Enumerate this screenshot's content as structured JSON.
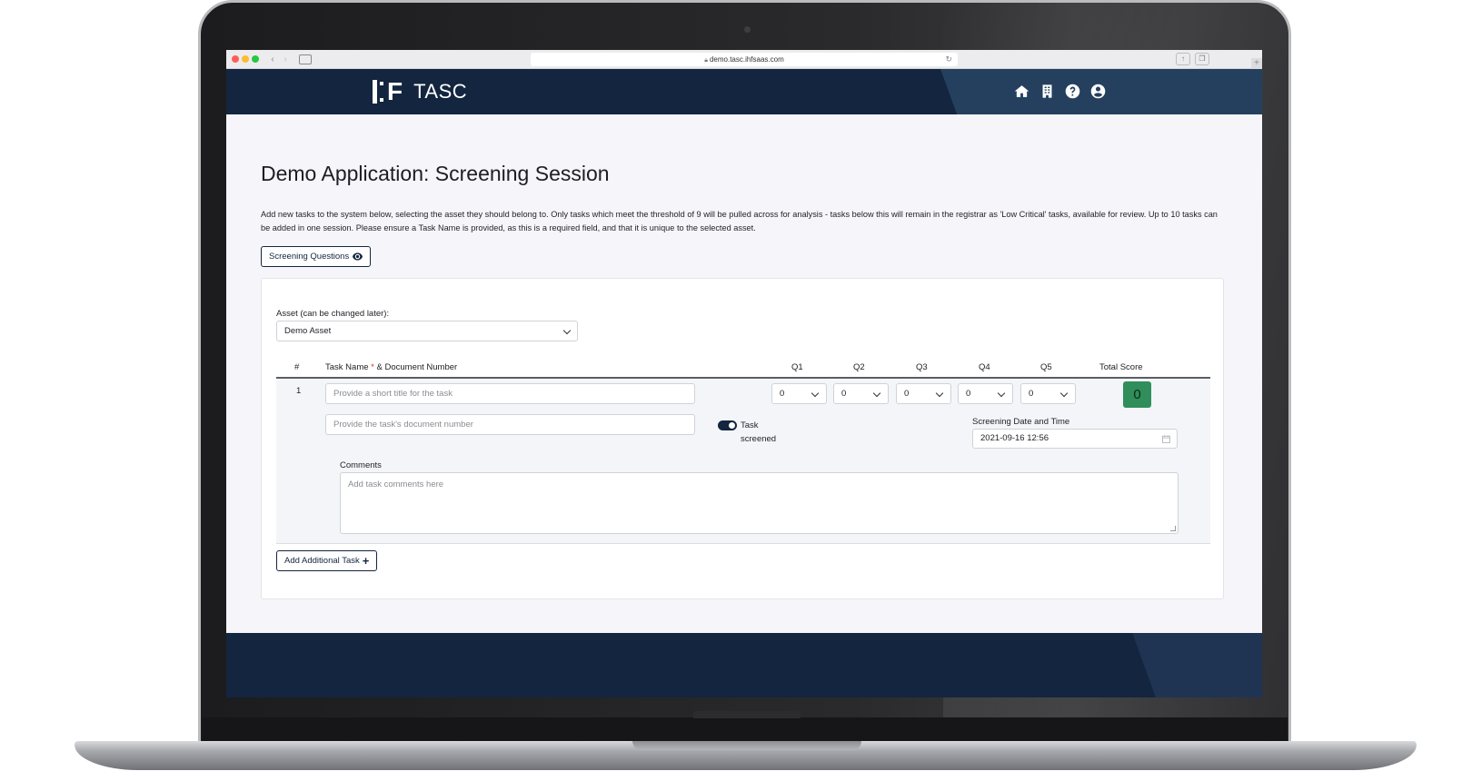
{
  "browser": {
    "url": "demo.tasc.ihfsaas.com"
  },
  "header": {
    "logo_mark": "F",
    "app_name": "TASC",
    "icons": [
      "home-icon",
      "building-icon",
      "help-icon",
      "user-icon"
    ]
  },
  "page": {
    "title": "Demo Application: Screening Session",
    "intro": "Add new tasks to the system below, selecting the asset they should belong to. Only tasks which meet the threshold of 9 will be pulled across for analysis - tasks below this will remain in the registrar as 'Low Critical' tasks, available for review. Up to 10 tasks can be added in one session. Please ensure a Task Name is provided, as this is a required field, and that it is unique to the selected asset.",
    "screening_questions_label": "Screening Questions"
  },
  "form": {
    "asset_label": "Asset (can be changed later):",
    "asset_value": "Demo Asset",
    "columns": {
      "num": "#",
      "task_name": "Task Name",
      "required_mark": "*",
      "task_name_suffix": "& Document Number",
      "q1": "Q1",
      "q2": "Q2",
      "q3": "Q3",
      "q4": "Q4",
      "q5": "Q5",
      "total": "Total Score"
    },
    "row": {
      "number": "1",
      "task_name_placeholder": "Provide a short title for the task",
      "doc_number_placeholder": "Provide the task's document number",
      "q_values": [
        "0",
        "0",
        "0",
        "0",
        "0"
      ],
      "total_score": "0",
      "toggle_label": "Task screened",
      "toggle_on": true,
      "date_label": "Screening Date and Time",
      "date_value": "2021-09-16 12:56",
      "comments_label": "Comments",
      "comments_placeholder": "Add task comments here"
    },
    "add_task_label": "Add Additional Task"
  },
  "colors": {
    "navy": "#13253f",
    "score_green": "#2f8e5a",
    "required_red": "#dd3333"
  }
}
